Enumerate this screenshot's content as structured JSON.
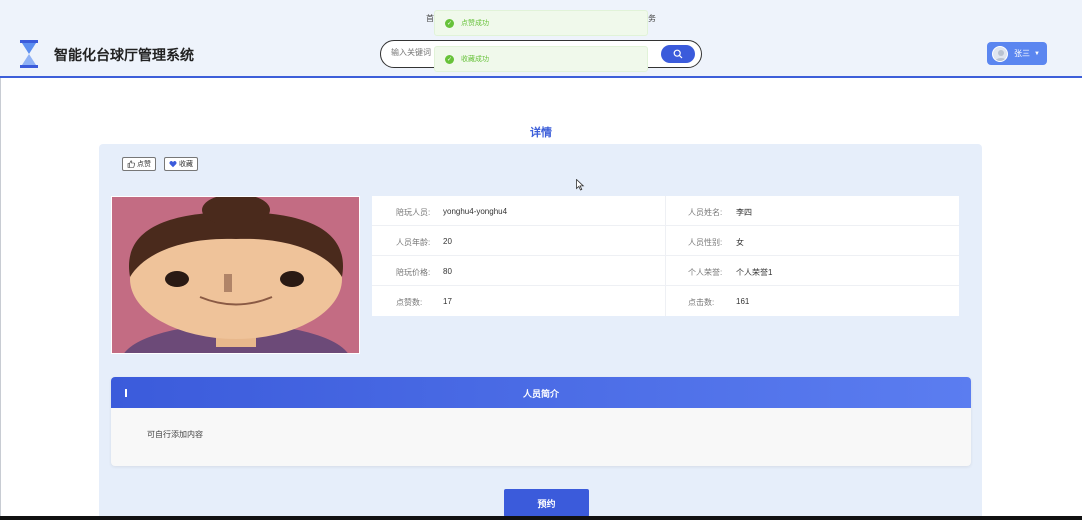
{
  "header": {
    "site_title": "智能化台球厅管理系统",
    "nav_fragment_left": "首",
    "nav_fragment_right": "务",
    "search_placeholder": "输入关键词",
    "user_name": "张三",
    "accent": "#3b5bdb"
  },
  "toasts": [
    {
      "text": "点赞成功",
      "color": "#67c23a"
    },
    {
      "text": "收藏成功",
      "color": "#67c23a"
    }
  ],
  "detail": {
    "title": "详情",
    "like_label": "点赞",
    "favorite_label": "收藏",
    "fields": [
      {
        "label": "陪玩人员:",
        "value": "yonghu4-yonghu4"
      },
      {
        "label": "人员姓名:",
        "value": "李四"
      },
      {
        "label": "人员年龄:",
        "value": "20"
      },
      {
        "label": "人员性别:",
        "value": "女"
      },
      {
        "label": "陪玩价格:",
        "value": "80"
      },
      {
        "label": "个人荣誉:",
        "value": "个人荣誉1"
      },
      {
        "label": "点赞数:",
        "value": "17"
      },
      {
        "label": "点击数:",
        "value": "161"
      }
    ],
    "intro_title": "人员简介",
    "intro_text": "可自行添加内容",
    "book_label": "预约"
  }
}
